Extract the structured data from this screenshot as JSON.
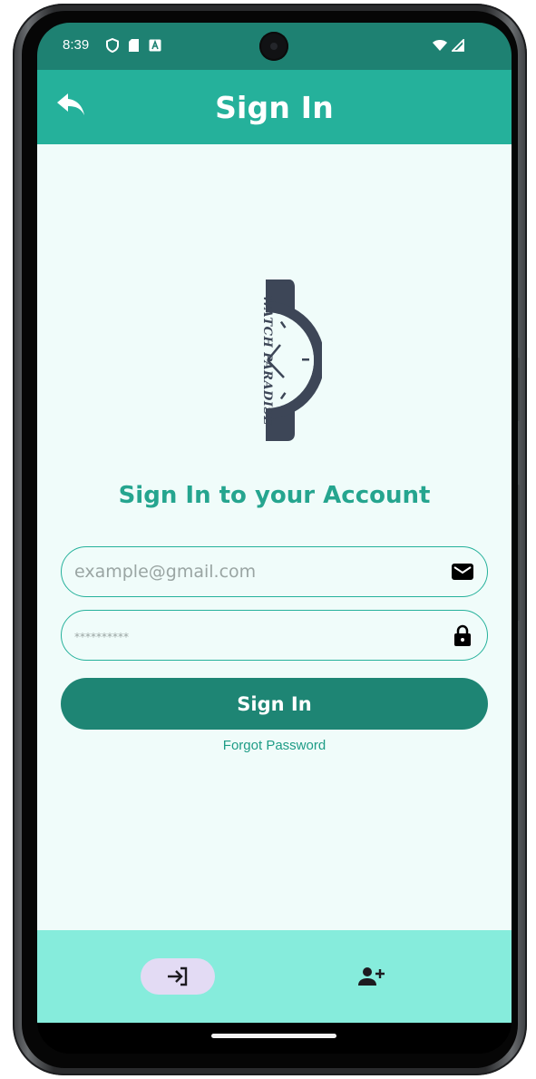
{
  "status_bar": {
    "time": "8:39",
    "left_icons": [
      "shield-icon",
      "sd-card-icon",
      "a-badge-icon"
    ],
    "right_icons": [
      "wifi-icon",
      "signal-icon"
    ]
  },
  "app_bar": {
    "title": "Sign In",
    "back_icon": "reply-arrow-icon"
  },
  "logo": {
    "text": "WATCH PARADISE"
  },
  "main": {
    "heading": "Sign In to your Account",
    "email": {
      "placeholder": "example@gmail.com",
      "value": "",
      "icon": "mail-icon"
    },
    "password": {
      "placeholder": "**********",
      "value": "",
      "icon": "lock-icon"
    },
    "sign_in_label": "Sign In",
    "forgot_label": "Forgot Password"
  },
  "bottom_nav": {
    "items": [
      {
        "icon": "login-icon",
        "selected": true
      },
      {
        "icon": "person-add-icon",
        "selected": false
      }
    ]
  },
  "colors": {
    "status_bar": "#1e8172",
    "app_bar": "#25b19b",
    "background": "#f0fcfa",
    "accent": "#25a58f",
    "button": "#1e8574",
    "bottom_nav": "#86ecdc",
    "nav_selected_pill": "#e3dbf4",
    "logo": "#3d4657"
  }
}
